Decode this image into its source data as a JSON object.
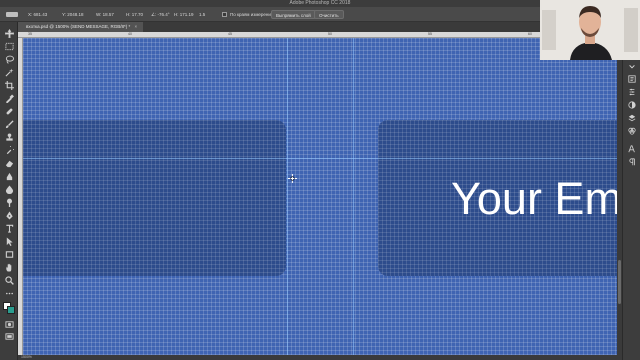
{
  "app": {
    "title": "Adobe Photoshop CC 2018"
  },
  "options_bar": {
    "x_readout": "X: 681.43",
    "y_readout": "Y: 2048.18",
    "w_readout": "W: 18.57",
    "h_readout": "H: 17.70",
    "angle_readout": "∠: -76.4°",
    "hskew_readout": "H: 171.19",
    "vskew_readout": "1.5",
    "sample_checkbox_label": "По краям измерений",
    "straighten_button": "Выпрямить слой",
    "clear_button": "Очистить"
  },
  "document_tab": {
    "label": "вхотка.psd @ 1500% (SEND MESSAGE, RGB/8*) *",
    "close_glyph": "×"
  },
  "ruler": {
    "top_ticks": [
      "35",
      "40",
      "45",
      "50",
      "55",
      "60"
    ]
  },
  "canvas": {
    "email_text": "Your Em",
    "colors": {
      "background": "#3f64b2",
      "box": "#2d4c8c",
      "text": "#ffffff"
    }
  },
  "status": {
    "zoom": "1500%"
  },
  "toolbar": {
    "tools": [
      "move-tool-icon",
      "marquee-tool-icon",
      "lasso-tool-icon",
      "magic-wand-icon",
      "crop-tool-icon",
      "eyedropper-icon",
      "healing-brush-icon",
      "brush-tool-icon",
      "clone-stamp-icon",
      "history-brush-icon",
      "eraser-tool-icon",
      "gradient-tool-icon",
      "blur-tool-icon",
      "dodge-tool-icon",
      "pen-tool-icon",
      "type-tool-icon",
      "path-selection-icon",
      "rectangle-tool-icon",
      "hand-tool-icon",
      "zoom-tool-icon",
      "more-tools-icon"
    ]
  },
  "right_panel": {
    "icons": [
      "collapse-panel-icon",
      "history-panel-icon",
      "properties-panel-icon",
      "adjustments-panel-icon",
      "layers-panel-icon",
      "channels-panel-icon",
      "character-panel-icon",
      "paragraph-panel-icon"
    ]
  }
}
